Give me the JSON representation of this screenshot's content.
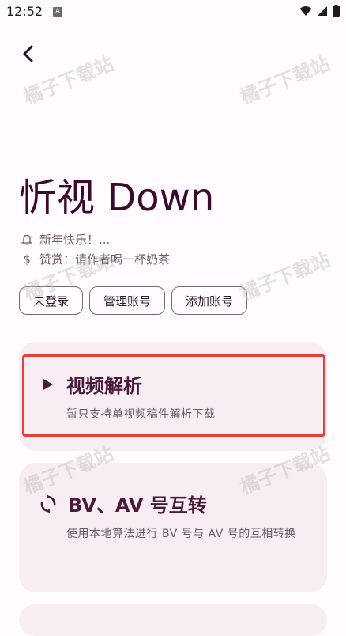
{
  "status_bar": {
    "time": "12:52",
    "indicator": "A"
  },
  "header": {
    "back_icon": "chevron-left-icon"
  },
  "app": {
    "title": "忻视 Down",
    "notice": "新年快乐！...",
    "donate": "赞赏：请作者喝一杯奶茶"
  },
  "account_buttons": [
    "未登录",
    "管理账号",
    "添加账号"
  ],
  "cards": [
    {
      "icon": "play-icon",
      "title": "视频解析",
      "desc": "暂只支持单视频稿件解析下载"
    },
    {
      "icon": "sync-icon",
      "title": "BV、AV 号互转",
      "desc": "使用本地算法进行 BV 号与 AV 号的互相转换"
    }
  ],
  "watermark": "橘子下载站",
  "colors": {
    "background": "#fffbfe",
    "card": "#f7edf3",
    "accent": "#3b0a2e",
    "highlight": "#e0413b"
  }
}
